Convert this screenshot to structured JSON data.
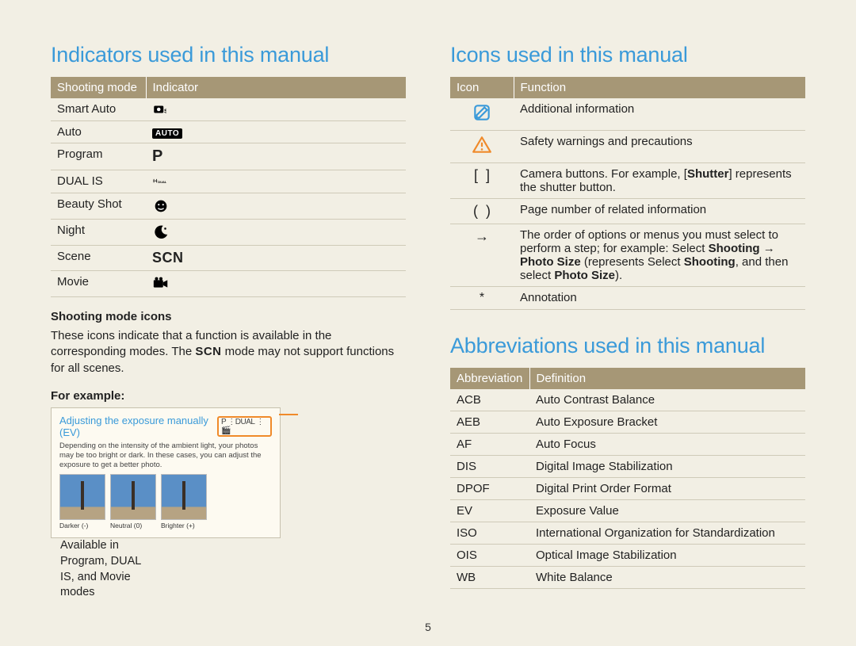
{
  "page_number": "5",
  "left": {
    "title": "Indicators used in this manual",
    "table_header": {
      "a": "Shooting mode",
      "b": "Indicator"
    },
    "rows": [
      {
        "label": "Smart Auto",
        "icon": "smart-auto"
      },
      {
        "label": "Auto",
        "icon": "auto-badge"
      },
      {
        "label": "Program",
        "icon": "letter-p"
      },
      {
        "label": "DUAL IS",
        "icon": "dual-is"
      },
      {
        "label": "Beauty Shot",
        "icon": "beauty-face"
      },
      {
        "label": "Night",
        "icon": "night"
      },
      {
        "label": "Scene",
        "icon": "scn"
      },
      {
        "label": "Movie",
        "icon": "movie"
      }
    ],
    "sub1_title": "Shooting mode icons",
    "sub1_text_a": "These icons indicate that a function is available in the corresponding modes. The ",
    "sub1_scn": "SCN",
    "sub1_text_b": " mode may not support functions for all scenes.",
    "sub2_title": "For example:",
    "example": {
      "heading": "Adjusting the exposure manually (EV)",
      "modes_chip": "P ⋮DUAL ⋮🎬",
      "desc": "Depending on the intensity of the ambient light, your photos may be too bright or dark. In these cases, you can adjust the exposure to get a better photo.",
      "thumbs": [
        {
          "cap": "Darker (-)"
        },
        {
          "cap": "Neutral (0)"
        },
        {
          "cap": "Brighter (+)"
        }
      ]
    },
    "side_note": "Available in Program, DUAL IS, and Movie modes"
  },
  "right": {
    "icons_title": "Icons used in this manual",
    "icons_header": {
      "a": "Icon",
      "b": "Function"
    },
    "icons_rows": [
      {
        "icon": "notepad",
        "text": "Additional information"
      },
      {
        "icon": "warning",
        "text": "Safety warnings and precautions"
      },
      {
        "icon": "brackets",
        "text_html": "Camera buttons. For example, [<b>Shutter</b>] represents the shutter button."
      },
      {
        "icon": "parens",
        "text": "Page number of related information"
      },
      {
        "icon": "arrow",
        "text_html": "The order of options or menus you must select to perform a step; for example: Select <b>Shooting</b> → <b>Photo Size</b> (represents Select <b>Shooting</b>, and then select <b>Photo Size</b>)."
      },
      {
        "icon": "asterisk",
        "text": "Annotation"
      }
    ],
    "abbr_title": "Abbreviations used in this manual",
    "abbr_header": {
      "a": "Abbreviation",
      "b": "Definition"
    },
    "abbr_rows": [
      {
        "a": "ACB",
        "b": "Auto Contrast Balance"
      },
      {
        "a": "AEB",
        "b": "Auto Exposure Bracket"
      },
      {
        "a": "AF",
        "b": "Auto Focus"
      },
      {
        "a": "DIS",
        "b": "Digital Image Stabilization"
      },
      {
        "a": "DPOF",
        "b": "Digital Print Order Format"
      },
      {
        "a": "EV",
        "b": "Exposure Value"
      },
      {
        "a": "ISO",
        "b": "International Organization for Standardization"
      },
      {
        "a": "OIS",
        "b": "Optical Image Stabilization"
      },
      {
        "a": "WB",
        "b": "White Balance"
      }
    ]
  }
}
